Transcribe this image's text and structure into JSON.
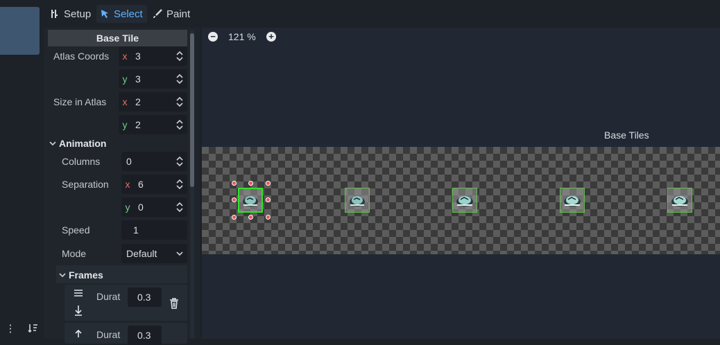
{
  "toolbar": {
    "setup": "Setup",
    "select": "Select",
    "paint": "Paint",
    "active": "select"
  },
  "props": {
    "base_tile_header": "Base Tile",
    "atlas_coords": {
      "label": "Atlas Coords",
      "x": "3",
      "y": "3"
    },
    "size_in_atlas": {
      "label": "Size in Atlas",
      "x": "2",
      "y": "2"
    },
    "axis_x": "x",
    "axis_y": "y",
    "animation": {
      "header": "Animation",
      "columns": {
        "label": "Columns",
        "value": "0"
      },
      "separation": {
        "label": "Separation",
        "x": "6",
        "y": "0"
      },
      "speed": {
        "label": "Speed",
        "value": "1"
      },
      "mode": {
        "label": "Mode",
        "value": "Default"
      }
    },
    "frames": {
      "header": "Frames",
      "items": [
        {
          "label": "Durat",
          "value": "0.3"
        },
        {
          "label": "Durat",
          "value": "0.3"
        }
      ]
    }
  },
  "view": {
    "zoom": "121 %",
    "atlas_title": "Base Tiles"
  },
  "colors": {
    "accent": "#5fb2ff",
    "selection_border": "#33e22c",
    "tile_border": "#5fbf4a",
    "handle": "#e65757"
  }
}
